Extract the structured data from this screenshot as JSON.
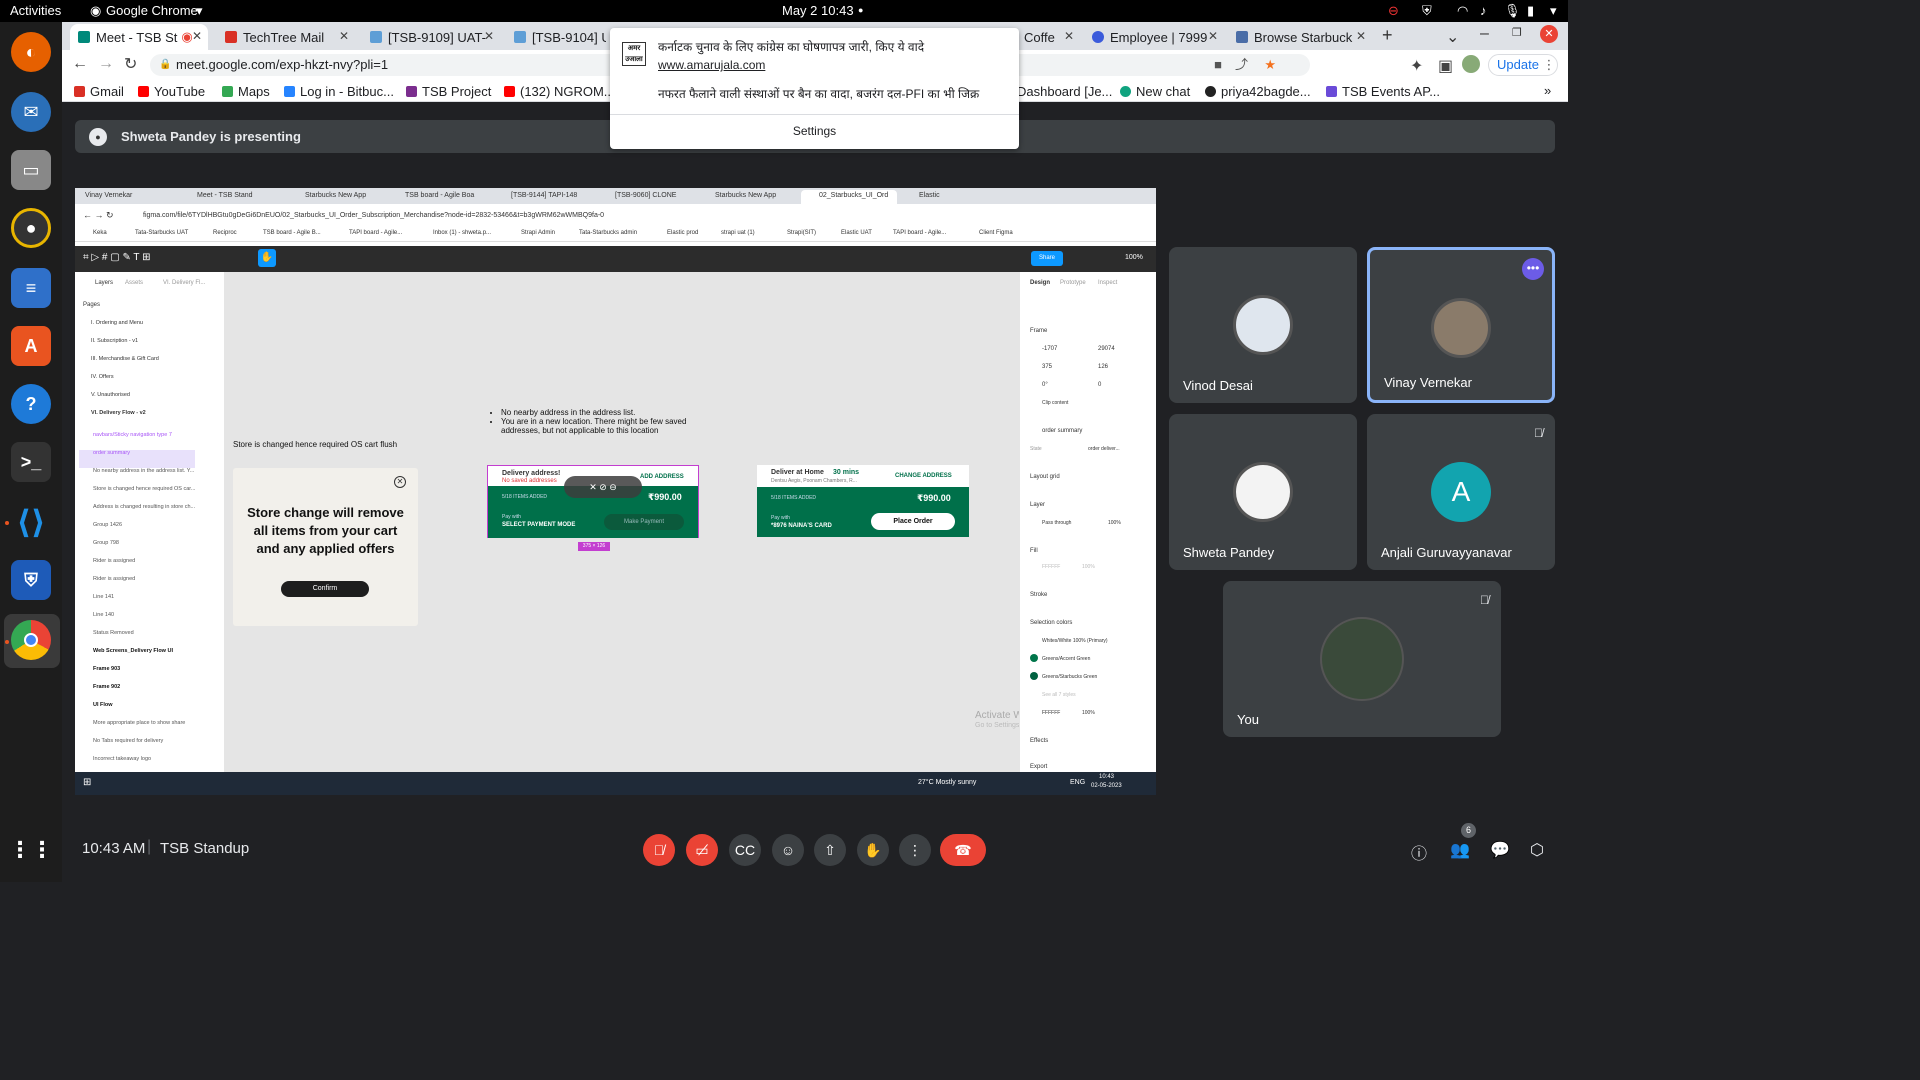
{
  "system": {
    "activities": "Activities",
    "app": "Google Chrome",
    "datetime": "May 2  10:43"
  },
  "chrome": {
    "tabs": [
      "Meet - TSB St",
      "TechTree Mail",
      "[TSB-9109] UAT-",
      "[TSB-9104] UA",
      "Coffe",
      "Employee | 7999",
      "Browse Starbuck"
    ],
    "url": "meet.google.com/exp-hkzt-nvy?pli=1",
    "update": "Update",
    "bookmarks": [
      "Gmail",
      "YouTube",
      "Maps",
      "Log in - Bitbuc...",
      "TSB Project",
      "(132) NGROM...",
      "Dashboard [Je...",
      "New chat",
      "priya42bagde...",
      "TSB Events AP..."
    ]
  },
  "notification": {
    "source": "अमर उजाला",
    "title": "कर्नाटक चुनाव के लिए कांग्रेस का घोषणापत्र जारी, किए ये वादे",
    "link": "www.amarujala.com",
    "body": "नफरत फैलाने वाली संस्थाओं पर बैन का वादा, बजरंग दल-PFI का भी जिक्र",
    "settings": "Settings"
  },
  "meet": {
    "presenting": "Shweta Pandey is presenting",
    "time": "10:43 AM",
    "meeting": "TSB Standup",
    "people_count": "6",
    "participants": [
      "Vinod Desai",
      "Vinay Vernekar",
      "Shweta Pandey",
      "Anjali Guruvayyanavar",
      "You"
    ],
    "anjali_initial": "A"
  },
  "shared": {
    "tabs": [
      "Vinay Vernekar",
      "Meet - TSB Stand",
      "Starbucks New App",
      "TSB board - Agile Boa",
      "[TSB-9144] TAPI-148",
      "[TSB-9060] CLONE",
      "Starbucks New App",
      "02_Starbucks_UI_Ord",
      "Elastic"
    ],
    "url": "figma.com/file/6TYDlHBGtu0gDeGi6DnEUO/02_Starbucks_UI_Order_Subscription_Merchandise?node-id=2832-53466&t=b3gWRM62wWMBQ9fa-0",
    "bookmarks": [
      "Keka",
      "Tata-Starbucks UAT",
      "Reciproc",
      "TSB board - Agile B...",
      "TAPI board - Agile...",
      "Inbox (1) - shweta.p...",
      "Strapi Admin",
      "Tata-Starbucks admin",
      "Elastic prod",
      "strapi uat (1)",
      "Strapi(SIT)",
      "Elastic UAT",
      "TAPI board - Agile...",
      "Client Figma"
    ],
    "figma": {
      "panel_tabs": [
        "Layers",
        "Assets",
        "VI. Delivery Fl..."
      ],
      "pages_label": "Pages",
      "pages": [
        "I. Ordering and Menu",
        "II. Subscription - v1",
        "III. Merchandise & Gift Card",
        "IV. Offers",
        "V. Unauthorised",
        "VI. Delivery Flow - v2"
      ],
      "layers": [
        "navbars/Sticky navigation type 7",
        "order summary",
        "No nearby address in the address list. Y...",
        "Store is changed hence required OS car...",
        "Address is changed resulting in store ch...",
        "Group 1426",
        "Group 798",
        "Rider is assigned",
        "Rider is assigned",
        "Line 141",
        "Line 140",
        "Status Removed",
        "Web Screens_Delivery Flow UI",
        "Frame 903",
        "Frame 902",
        "UI Flow",
        "More appropriate place to show share",
        "No Tabs required for delivery",
        "Incorrect takeaway logo"
      ],
      "share": "Share",
      "zoom": "100%",
      "store_note": "Store is changed hence required OS cart flush",
      "store_modal_text": "Store change will remove all items from your cart and any applied offers",
      "confirm": "Confirm",
      "bullets": [
        "No nearby address in the address list.",
        "You are in a new location. There might be few saved addresses, but not applicable to this location"
      ],
      "card1": {
        "title": "Delivery address!",
        "sub": "No saved addresses",
        "add": "ADD ADDRESS",
        "items": "5/18 ITEMS ADDED",
        "price": "₹990.00",
        "pay": "Pay with",
        "mode": "SELECT PAYMENT MODE",
        "btn": "Make Payment",
        "size": "375 × 126"
      },
      "card2": {
        "title": "Deliver at Home",
        "mins": "30 mins",
        "addr": "Dentsu Aegis, Poonam Chambers, R...",
        "change": "CHANGE ADDRESS",
        "items": "5/18 ITEMS ADDED",
        "price": "₹990.00",
        "pay": "Pay with",
        "card": "*8976 NAINA'S CARD",
        "btn": "Place Order"
      },
      "right_tabs": [
        "Design",
        "Prototype",
        "Inspect"
      ],
      "frame": "Frame",
      "x": "-1707",
      "y": "29074",
      "w": "375",
      "h": "126",
      "rot": "0°",
      "rad": "0",
      "clip": "Clip content",
      "component": "order summary",
      "state_label": "State",
      "state_val": "order deliver...",
      "layout_grid": "Layout grid",
      "layer_label": "Layer",
      "pass": "Pass through",
      "opacity": "100%",
      "fill": "Fill",
      "fill_hex": "FFFFFF",
      "fill_op": "100%",
      "stroke": "Stroke",
      "sel_colors": "Selection colors",
      "colors": [
        "Whites/White 100% (Primary)",
        "Greens/Accent Green",
        "Greens/Starbucks Green"
      ],
      "see_all": "See all 7 styles",
      "hex2": "FFFFFF",
      "hex2_op": "100%",
      "effects": "Effects",
      "export": "Export",
      "activate1": "Activate Windows",
      "activate2": "Go to Settings to activate Windows."
    },
    "taskbar": {
      "weather": "27°C  Mostly sunny",
      "lang": "ENG",
      "time": "10:43",
      "date": "02-05-2023"
    }
  }
}
